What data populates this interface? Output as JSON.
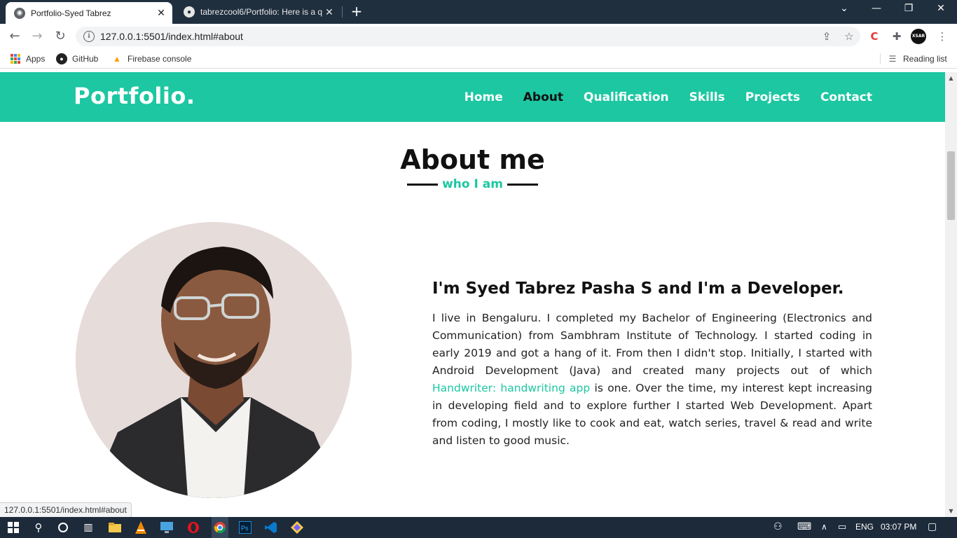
{
  "browser": {
    "tabs": [
      {
        "title": "Portfolio-Syed Tabrez",
        "active": true
      },
      {
        "title": "tabrezcool6/Portfolio: Here is a q",
        "active": false
      }
    ],
    "url": "127.0.0.1:5501/index.html#about",
    "status_url": "127.0.0.1:5501/index.html#about",
    "profile_text": "XSAR",
    "bookmarks": [
      {
        "label": "Apps",
        "icon": "apps-grid-icon"
      },
      {
        "label": "GitHub",
        "icon": "github-icon"
      },
      {
        "label": "Firebase console",
        "icon": "firebase-icon"
      }
    ],
    "reading_list": "Reading list"
  },
  "site": {
    "logo": "Portfolio.",
    "nav": [
      "Home",
      "About",
      "Qualification",
      "Skills",
      "Projects",
      "Contact"
    ],
    "active_nav": "About",
    "accent": "#1cc7a2"
  },
  "about": {
    "title": "About me",
    "subtitle": "who I am",
    "heading": "I'm Syed Tabrez Pasha S and I'm a Developer.",
    "para_before_link": "I live in Bengaluru. I completed my Bachelor of Engineering (Electronics and Communication) from Sambhram Institute of Technology. I started coding in early 2019 and got a hang of it. From then I didn't stop. Initially, I started with Android Development (Java) and created many projects out of which ",
    "link_text": "Handwriter: handwriting app",
    "para_after_link": " is one. Over the time, my interest kept increasing in developing field and to explore further I started Web Development. Apart from coding, I mostly like to cook and eat, watch series, travel & read and write and listen to good music."
  },
  "taskbar": {
    "lang": "ENG",
    "time": "03:07 PM"
  }
}
